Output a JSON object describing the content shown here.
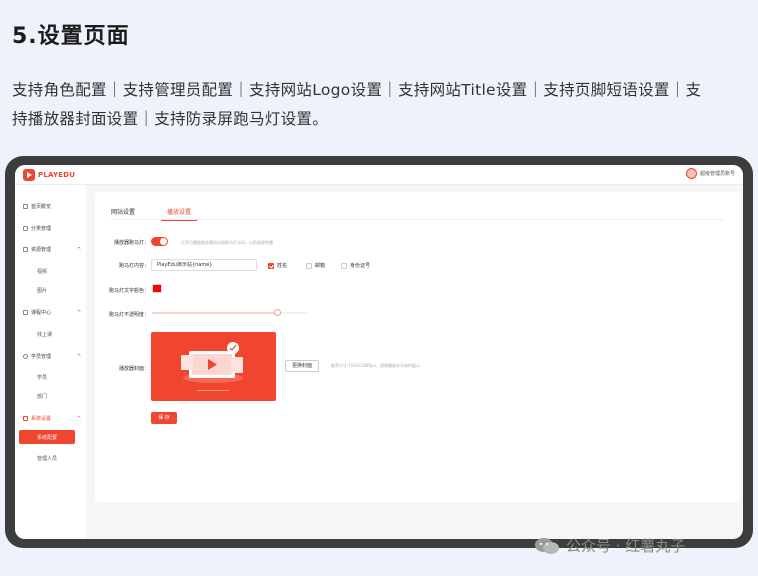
{
  "heading": "5.设置页面",
  "description_line1": "支持角色配置｜支持管理员配置｜支持网站Logo设置｜支持网站Title设置｜支持页脚短语设置｜支",
  "description_line2": "持播放器封面设置｜支持防录屏跑马灯设置。",
  "app": {
    "logo_text": "PLAYEDU",
    "user_name": "超级管理员账号"
  },
  "sidebar": {
    "items": [
      {
        "label": "首页概览"
      },
      {
        "label": "分类管理"
      },
      {
        "label": "资源管理",
        "arrow": "^"
      },
      {
        "label": "视频"
      },
      {
        "label": "图片"
      },
      {
        "label": "课程中心",
        "arrow": "^"
      },
      {
        "label": "线上课"
      },
      {
        "label": "学员管理",
        "arrow": "^"
      },
      {
        "label": "学员"
      },
      {
        "label": "部门"
      },
      {
        "label": "系统设置",
        "arrow": "^"
      },
      {
        "label": "系统配置"
      },
      {
        "label": "管理人员"
      }
    ]
  },
  "tabs": [
    {
      "label": "网站设置"
    },
    {
      "label": "播放设置"
    }
  ],
  "form": {
    "marquee_label": "播放器跑马灯：",
    "marquee_hint": "打开后播放器会随机出现跑马灯水印，以防录屏传播",
    "marquee_enabled": true,
    "content_label": "跑马灯内容：",
    "content_value": "PlayEdu演示站{name}",
    "checkbox_name": "姓名",
    "checkbox_name_checked": true,
    "checkbox_email": "邮箱",
    "checkbox_email_checked": false,
    "checkbox_idcard": "身份证号",
    "checkbox_idcard_checked": false,
    "color_label": "跑马灯文字颜色：",
    "color_value": "#ff0000",
    "opacity_label": "跑马灯不透明度：",
    "opacity_value": 0.8,
    "cover_label": "播放器封面：",
    "change_cover_button": "更换封面",
    "cover_hint": "推荐尺寸:1920x1080px，视频播放未开始时展示",
    "save_button": "保 存"
  },
  "colors": {
    "accent": "#f0452f",
    "marquee_color": "#ff0000"
  },
  "watermark": "公众号 · 红薯丸子"
}
